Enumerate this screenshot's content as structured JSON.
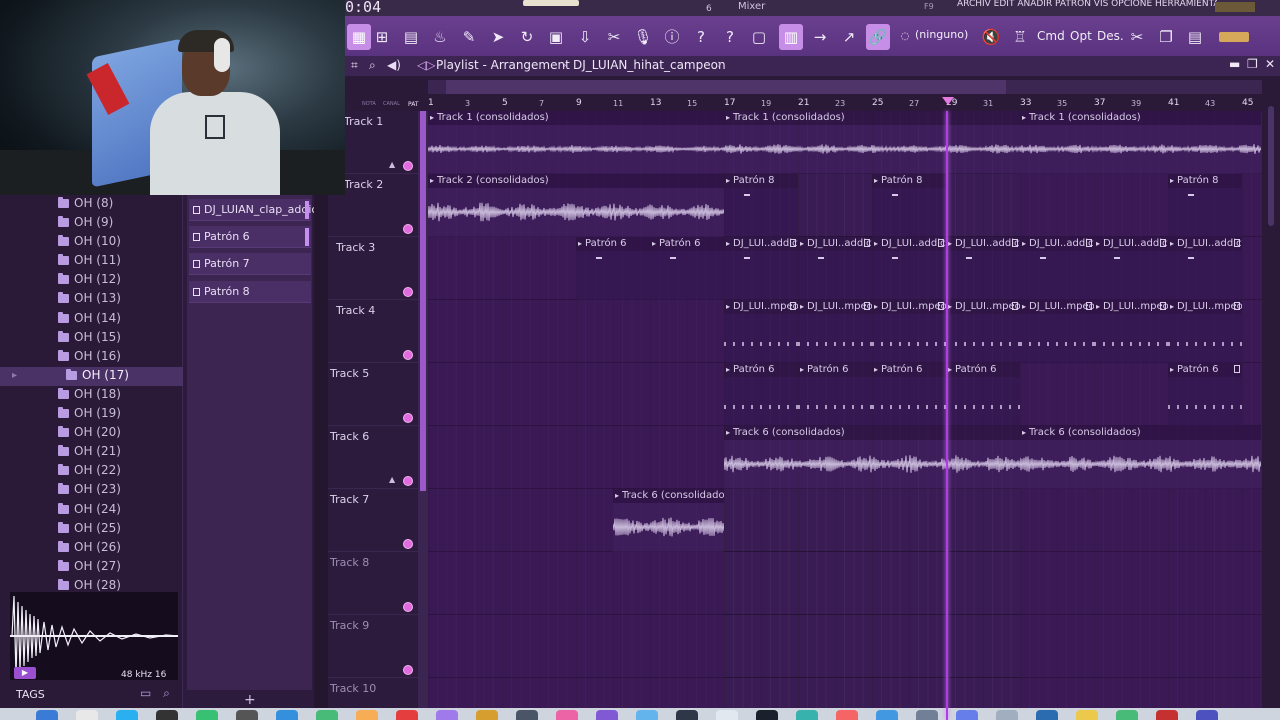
{
  "timer": "0:04",
  "topbar": {
    "mixer": "Mixer",
    "shortcut": "F9",
    "number": "6",
    "hint": "ARCHIV EDIT AÑADIR PATRÓN VIS OPCIONE HERRAMIENTAS"
  },
  "toolbar": {
    "none_label": "(ninguno)",
    "cmd": "Cmd",
    "opt": "Opt",
    "des": "Des."
  },
  "browser": {
    "items": [
      "OH (8)",
      "OH (9)",
      "OH (10)",
      "OH (11)",
      "OH (12)",
      "OH (13)",
      "OH (14)",
      "OH (15)",
      "OH (16)",
      "OH (17)",
      "OH (18)",
      "OH (19)",
      "OH (20)",
      "OH (21)",
      "OH (22)",
      "OH (23)",
      "OH (24)",
      "OH (25)",
      "OH (26)",
      "OH (27)",
      "OH (28)"
    ],
    "selected_index": 9,
    "sample_rate": "48 kHz 16",
    "tags": "TAGS"
  },
  "picker": {
    "items": [
      "DJ_LUIAN_clap_addicto",
      "Patrón 6",
      "Patrón 7",
      "Patrón 8"
    ]
  },
  "playlist": {
    "title": "Playlist - Arrangement",
    "separator": "›",
    "project": "DJ_LUIAN_hihat_campeon",
    "header_labels": {
      "note": "NOTA",
      "channel": "CANAL",
      "pat": "PAT"
    },
    "bar_numbers": [
      "1",
      "3",
      "5",
      "7",
      "9",
      "11",
      "13",
      "15",
      "17",
      "19",
      "21",
      "23",
      "25",
      "27",
      "29",
      "31",
      "33",
      "35",
      "37",
      "39",
      "41",
      "43",
      "45"
    ],
    "tracks": [
      "Track 1",
      "Track 2",
      "Track 3",
      "Track 4",
      "Track 5",
      "Track 6",
      "Track 7",
      "Track 8",
      "Track 9",
      "Track 10"
    ],
    "clip_labels": {
      "t1": "Track 1 (consolidados)",
      "t2": "Track 2 (consolidados)",
      "patron8": "Patrón 8",
      "patron6": "Patrón 6",
      "addicto": "DJ_LUI..addicto",
      "mpeon": "DJ_LUI..mpeon",
      "t6": "Track 6 (consolidados)"
    }
  },
  "colors": {
    "accent": "#c78ee8",
    "playhead": "#b23de6",
    "mute_dot": "#e36be0",
    "grid": "#3a1c54"
  }
}
